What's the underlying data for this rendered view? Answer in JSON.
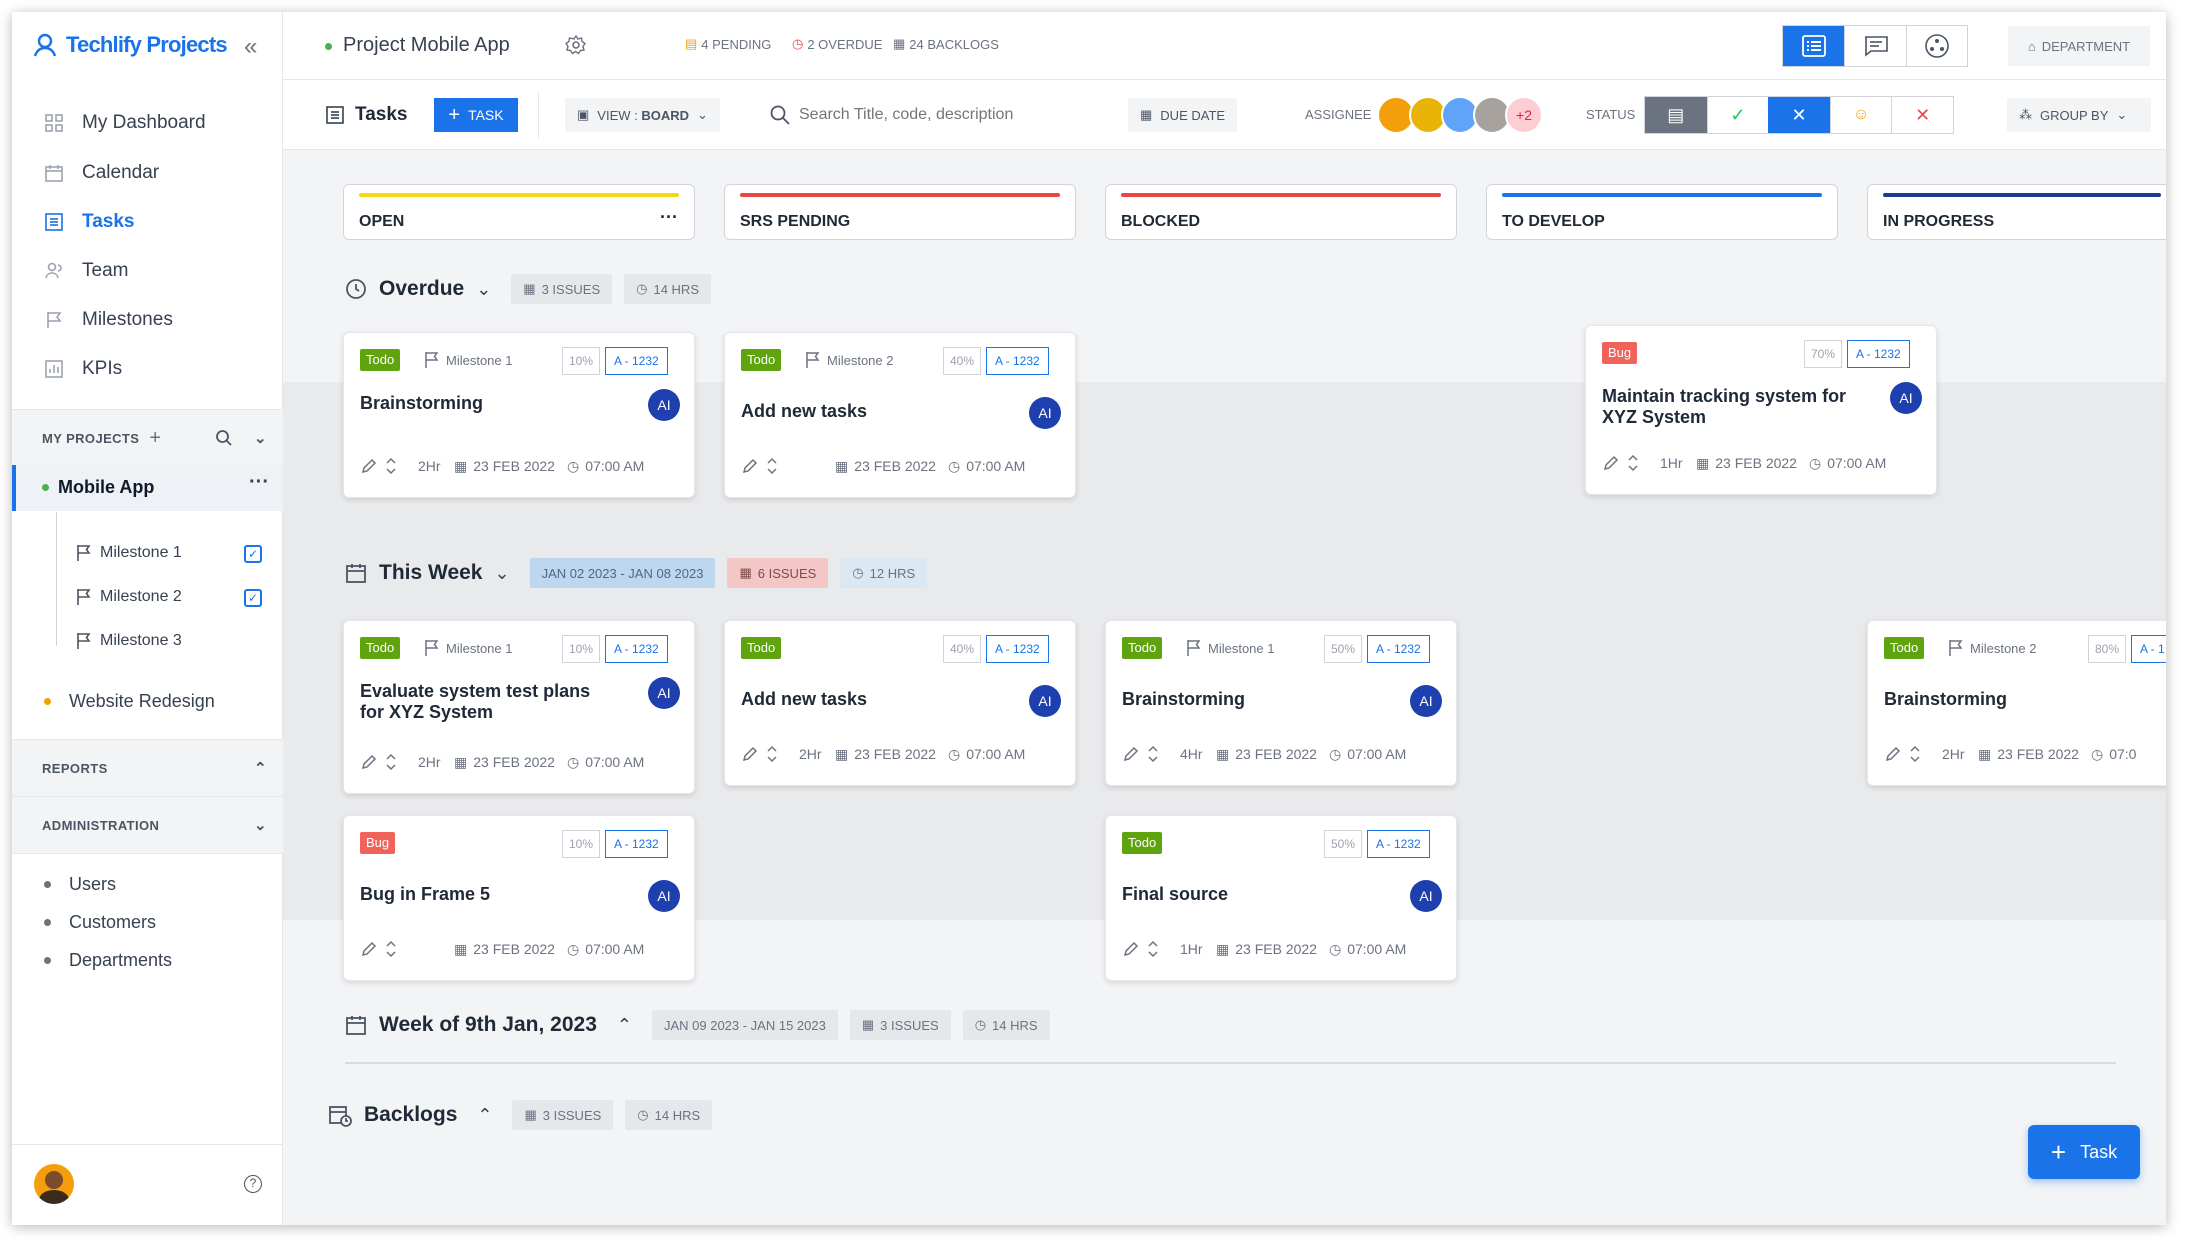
{
  "sidebar": {
    "brand": "Techlify Projects",
    "nav": [
      {
        "label": "My Dashboard",
        "icon": "grid-icon"
      },
      {
        "label": "Calendar",
        "icon": "calendar-icon"
      },
      {
        "label": "Tasks",
        "icon": "list-icon"
      },
      {
        "label": "Team",
        "icon": "team-icon"
      },
      {
        "label": "Milestones",
        "icon": "flag-icon"
      },
      {
        "label": "KPIs",
        "icon": "chart-icon"
      }
    ],
    "my_projects": "MY PROJECTS",
    "projects": [
      {
        "name": "Mobile App",
        "dot": "#4caf50",
        "milestones": [
          "Milestone 1",
          "Milestone 2",
          "Milestone 3"
        ]
      },
      {
        "name": "Website Redesign",
        "dot": "#f59e0b"
      }
    ],
    "reports": "REPORTS",
    "administration": "ADMINISTRATION",
    "admin_items": [
      "Users",
      "Customers",
      "Departments"
    ]
  },
  "header": {
    "project": "Project Mobile App",
    "pending": "4 PENDING",
    "overdue": "2 OVERDUE",
    "backlogs": "24 BACKLOGS",
    "department": "DEPARTMENT"
  },
  "toolbar": {
    "tasks": "Tasks",
    "add_task": "TASK",
    "view": "VIEW : ",
    "view_value": "BOARD",
    "search_placeholder": "Search Title, code, description",
    "due_date": "DUE DATE",
    "assignee": "ASSIGNEE",
    "more_assignees": "+2",
    "status": "STATUS",
    "group_by": "GROUP BY"
  },
  "columns": [
    {
      "name": "OPEN",
      "color": "#f5d90a"
    },
    {
      "name": "SRS PENDING",
      "color": "#ef4444"
    },
    {
      "name": "BLOCKED",
      "color": "#ef4444"
    },
    {
      "name": "TO DEVELOP",
      "color": "#1a73e8"
    },
    {
      "name": "IN PROGRESS",
      "color": "#1e3a8a"
    }
  ],
  "groups": {
    "overdue": {
      "title": "Overdue",
      "issues": "3 ISSUES",
      "hrs": "14 HRS"
    },
    "this_week": {
      "title": "This Week",
      "range": "JAN 02 2023 - JAN 08 2023",
      "issues": "6 ISSUES",
      "hrs": "12 HRS"
    },
    "next_week": {
      "title": "Week of 9th Jan, 2023",
      "range": "JAN 09 2023 - JAN 15 2023",
      "issues": "3 ISSUES",
      "hrs": "14 HRS"
    },
    "backlogs": {
      "title": "Backlogs",
      "issues": "3 ISSUES",
      "hrs": "14 HRS"
    }
  },
  "cards": [
    {
      "tag": "Todo",
      "milestone": "Milestone 1",
      "pct": "10%",
      "code": "A - 1232",
      "title": "Brainstorming",
      "avatar": "AI",
      "hours": "2Hr",
      "date": "23 FEB 2022",
      "time": "07:00 AM"
    },
    {
      "tag": "Todo",
      "milestone": "Milestone 2",
      "pct": "40%",
      "code": "A - 1232",
      "title": "Add new tasks",
      "avatar": "AI",
      "hours": "",
      "date": "23 FEB 2022",
      "time": "07:00 AM"
    },
    {
      "tag": "Bug",
      "milestone": "",
      "pct": "70%",
      "code": "A - 1232",
      "title": "Maintain tracking system for XYZ System",
      "avatar": "AI",
      "hours": "1Hr",
      "date": "23 FEB 2022",
      "time": "07:00 AM"
    },
    {
      "tag": "Todo",
      "milestone": "Milestone 1",
      "pct": "10%",
      "code": "A - 1232",
      "title": "Evaluate system test plans for XYZ System",
      "avatar": "AI",
      "hours": "2Hr",
      "date": "23 FEB 2022",
      "time": "07:00 AM"
    },
    {
      "tag": "Todo",
      "milestone": "",
      "pct": "40%",
      "code": "A - 1232",
      "title": "Add new tasks",
      "avatar": "AI",
      "hours": "2Hr",
      "date": "23 FEB 2022",
      "time": "07:00 AM"
    },
    {
      "tag": "Todo",
      "milestone": "Milestone 1",
      "pct": "50%",
      "code": "A - 1232",
      "title": "Brainstorming",
      "avatar": "AI",
      "hours": "4Hr",
      "date": "23 FEB 2022",
      "time": "07:00 AM"
    },
    {
      "tag": "Todo",
      "milestone": "Milestone 2",
      "pct": "80%",
      "code": "A - 1",
      "title": "Brainstorming",
      "avatar": "AI",
      "hours": "2Hr",
      "date": "23 FEB 2022",
      "time": "07:0"
    },
    {
      "tag": "Bug",
      "milestone": "",
      "pct": "10%",
      "code": "A - 1232",
      "title": "Bug in Frame 5",
      "avatar": "AI",
      "hours": "",
      "date": "23 FEB 2022",
      "time": "07:00 AM"
    },
    {
      "tag": "Todo",
      "milestone": "",
      "pct": "50%",
      "code": "A - 1232",
      "title": "Final source",
      "avatar": "AI",
      "hours": "1Hr",
      "date": "23 FEB 2022",
      "time": "07:00 AM"
    }
  ],
  "fab": "Task"
}
